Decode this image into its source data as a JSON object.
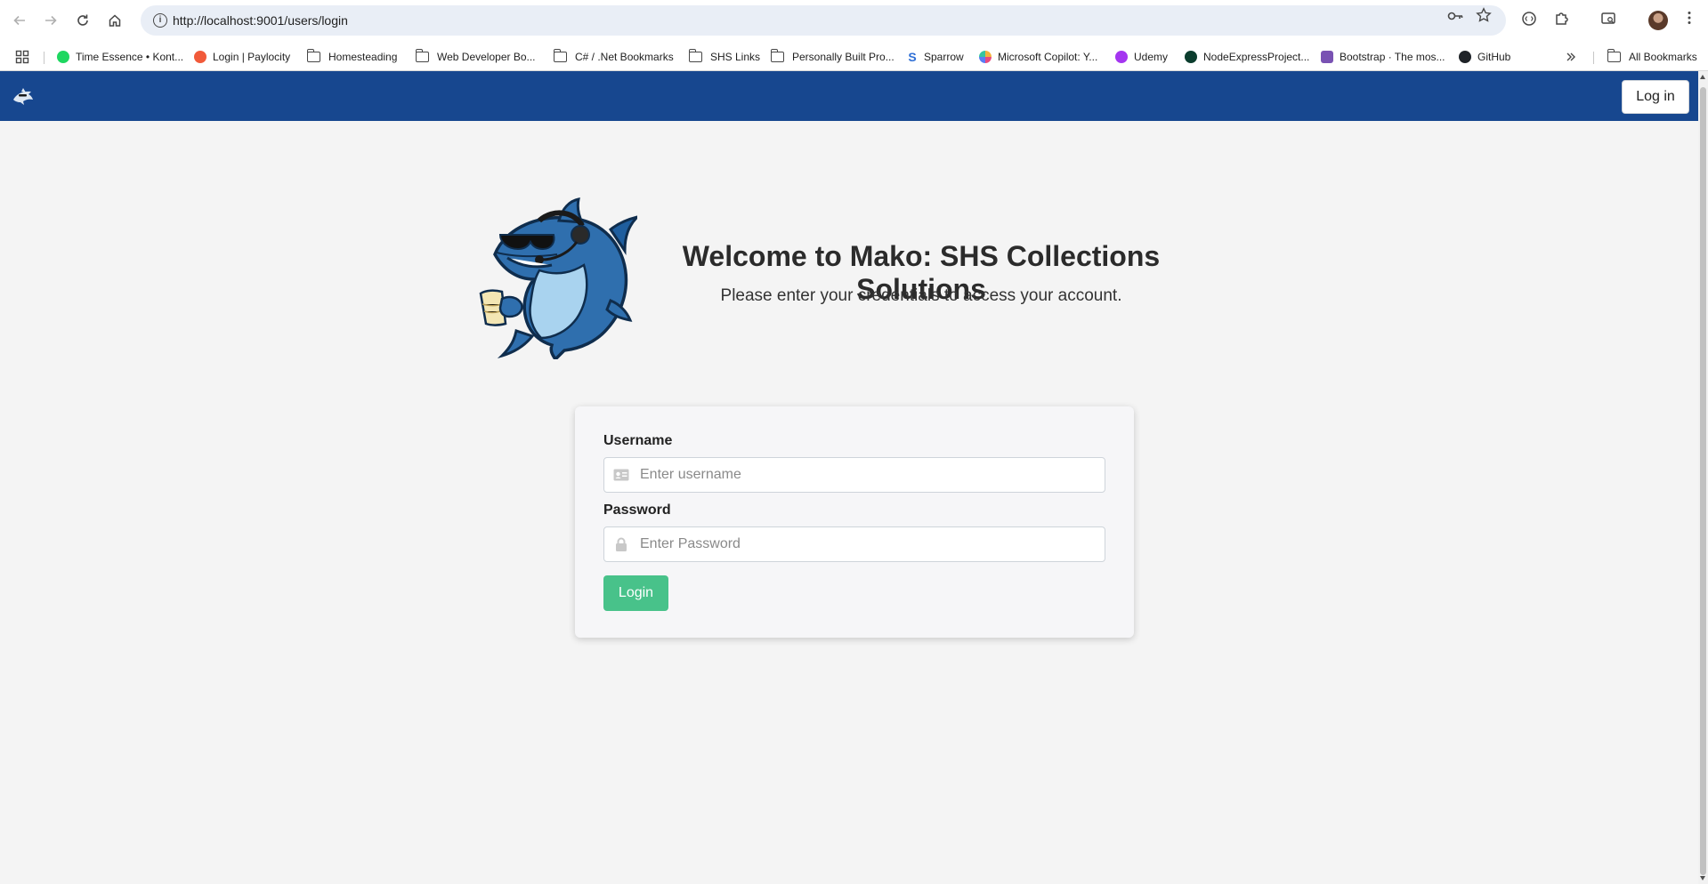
{
  "browser": {
    "url": "http://localhost:9001/users/login",
    "bookmarks": [
      {
        "label": "Time Essence • Kont...",
        "icon": "spotify-icon"
      },
      {
        "label": "Login | Paylocity",
        "icon": "paylocity-icon"
      },
      {
        "label": "Homesteading",
        "icon": "folder-icon"
      },
      {
        "label": "Web Developer Bo...",
        "icon": "folder-icon"
      },
      {
        "label": "C# / .Net Bookmarks",
        "icon": "folder-icon"
      },
      {
        "label": "SHS Links",
        "icon": "folder-icon"
      },
      {
        "label": "Personally Built Pro...",
        "icon": "folder-icon"
      },
      {
        "label": "Sparrow",
        "icon": "sparrow-icon"
      },
      {
        "label": "Microsoft Copilot: Y...",
        "icon": "copilot-icon"
      },
      {
        "label": "Udemy",
        "icon": "udemy-icon"
      },
      {
        "label": "NodeExpressProject...",
        "icon": "mongodb-icon"
      },
      {
        "label": "Bootstrap · The mos...",
        "icon": "bootstrap-icon"
      },
      {
        "label": "GitHub",
        "icon": "github-icon"
      }
    ],
    "all_bookmarks_label": "All Bookmarks"
  },
  "navbar": {
    "login_label": "Log in",
    "color": "#17478f"
  },
  "hero": {
    "title": "Welcome to Mako: SHS Collections Solutions",
    "subtitle": "Please enter your credentials to access your account."
  },
  "form": {
    "username_label": "Username",
    "username_placeholder": "Enter username",
    "username_value": "",
    "password_label": "Password",
    "password_placeholder": "Enter Password",
    "password_value": "",
    "submit_label": "Login",
    "submit_color": "#48c28a"
  }
}
